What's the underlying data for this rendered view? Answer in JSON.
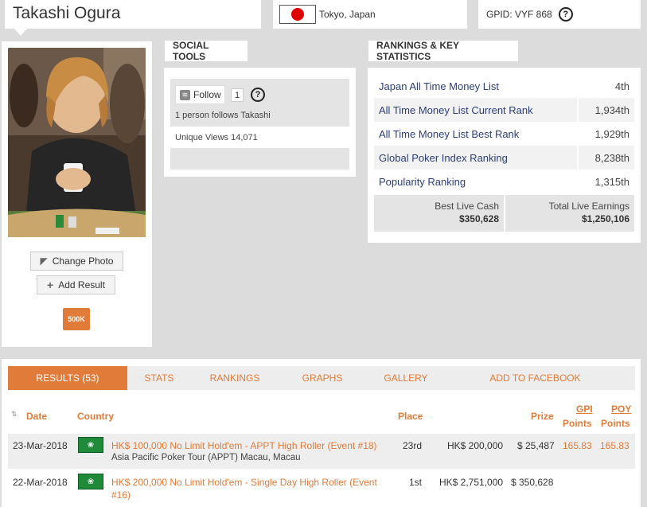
{
  "profile": {
    "name": "Takashi Ogura",
    "location": "Tokyo, Japan",
    "gpid": "GPID: VYF 868",
    "change_photo": "Change Photo",
    "add_result": "Add Result",
    "badge": "500K",
    "flag_color": "#e00000"
  },
  "social": {
    "header": "SOCIAL TOOLS",
    "follow_label": "Follow",
    "follow_count": "1",
    "help": "?",
    "follows_text": "1 person follows Takashi",
    "views": "Unique Views 14,071"
  },
  "rankings": {
    "header": "RANKINGS & KEY STATISTICS",
    "rows": [
      {
        "label": "Japan All Time Money List",
        "value": "4th"
      },
      {
        "label": "All Time Money List Current Rank",
        "value": "1,934th"
      },
      {
        "label": "All Time Money List Best Rank",
        "value": "1,929th"
      },
      {
        "label": "Global Poker Index Ranking",
        "value": "8,238th"
      },
      {
        "label": "Popularity Ranking",
        "value": "1,315th"
      }
    ],
    "best_live_cash_label": "Best Live Cash",
    "best_live_cash": "$350,628",
    "total_live_label": "Total Live Earnings",
    "total_live": "$1,250,106"
  },
  "tabs": [
    "RESULTS (53)",
    "STATS",
    "RANKINGS",
    "GRAPHS",
    "GALLERY",
    "ADD TO FACEBOOK"
  ],
  "table": {
    "headers": {
      "date": "Date",
      "country": "Country",
      "place": "Place",
      "prize": "Prize",
      "gpi1": "GPI",
      "gpi2": "Points",
      "poy1": "POY",
      "poy2": "Points"
    },
    "rows": [
      {
        "date": "23-Mar-2018",
        "event": "HK$ 100,000 No Limit Hold'em - APPT High Roller (Event #18)",
        "venue": "Asia Pacific Poker Tour (APPT) Macau, Macau",
        "place": "23rd",
        "local_prize": "HK$ 200,000",
        "prize": "$ 25,487",
        "gpi": "165.83",
        "poy": "165.83"
      },
      {
        "date": "22-Mar-2018",
        "event": "HK$ 200,000 No Limit Hold'em - Single Day High Roller (Event",
        "event2": "#16)",
        "place": "1st",
        "local_prize": "HK$ 2,751,000",
        "prize": "$ 350,628"
      }
    ]
  }
}
